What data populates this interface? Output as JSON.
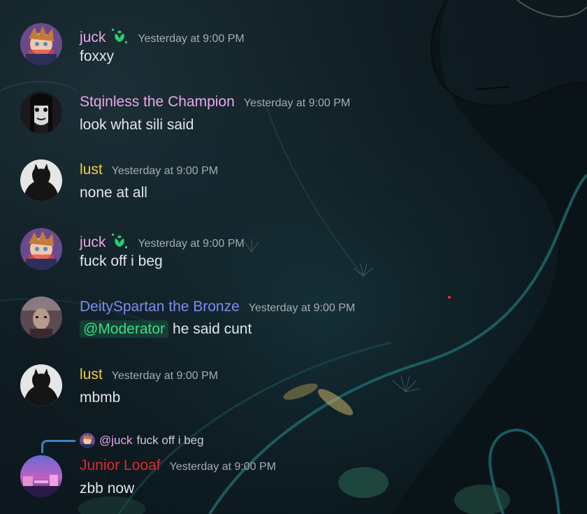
{
  "colors": {
    "juck": "#e8a8e8",
    "stqinless": "#e8a8e8",
    "lust": "#f2c94c",
    "deity": "#7d8cf0",
    "junior": "#e0282e",
    "badge": "#2ecc71",
    "reply_line": "#3b82c4"
  },
  "messages": [
    {
      "author": "juck",
      "has_badge": true,
      "badge_icon": "leaf-badge-icon",
      "timestamp": "Yesterday at 9:00 PM",
      "text": "foxxy"
    },
    {
      "author": "Stqinless the Champion",
      "timestamp": "Yesterday at 9:00 PM",
      "text": "look what sili said"
    },
    {
      "author": "lust",
      "timestamp": "Yesterday at 9:00 PM",
      "text": "none at all"
    },
    {
      "author": "juck",
      "has_badge": true,
      "badge_icon": "leaf-badge-icon",
      "timestamp": "Yesterday at 9:00 PM",
      "text": "fuck off i beg"
    },
    {
      "author": "DeitySpartan the Bronze",
      "timestamp": "Yesterday at 9:00 PM",
      "mention": "@Moderator",
      "text": "he said cunt"
    },
    {
      "author": "lust",
      "timestamp": "Yesterday at 9:00 PM",
      "text": "mbmb"
    },
    {
      "author": "Junior Looaf",
      "timestamp": "Yesterday at 9:00 PM",
      "text": "zbb now",
      "reply": {
        "author": "@juck",
        "text": "fuck off i beg"
      }
    }
  ]
}
